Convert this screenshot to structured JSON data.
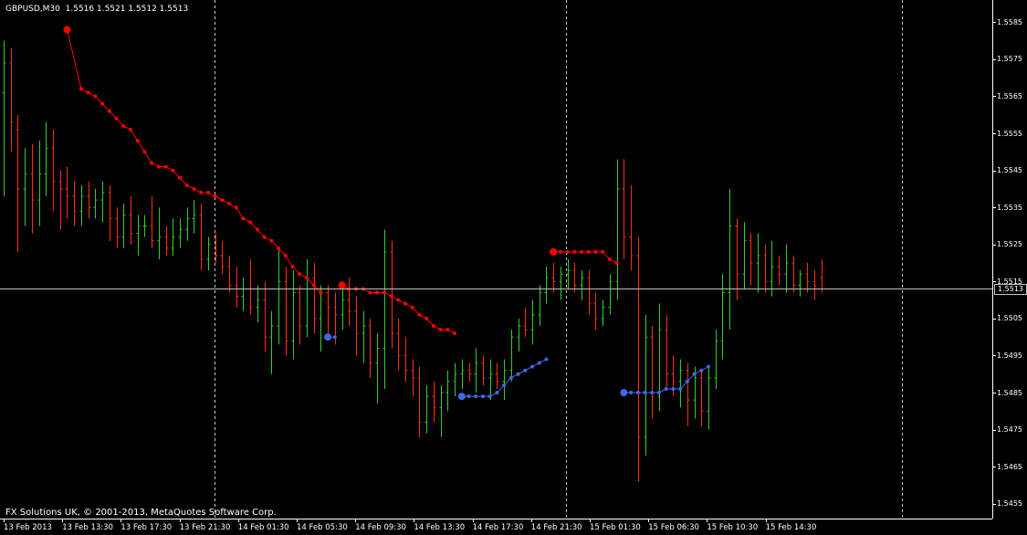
{
  "header": {
    "symbol_timeframe": "GBPUSD,M30",
    "ohlc": "1.5516 1.5521 1.5512 1.5513"
  },
  "footer": {
    "copyright": "FX Solutions UK, © 2001-2013, MetaQuotes Software Corp."
  },
  "colors": {
    "background": "#000000",
    "bull_bar": "#32cd32",
    "bear_bar": "#ff2b1a",
    "upper_indicator": "#ff0000",
    "lower_indicator": "#4169e1",
    "grid": "#c8c8c8",
    "axis_text": "#ffffff"
  },
  "current_price": "1.5513",
  "price_axis": [
    "1.5585",
    "1.5575",
    "1.5565",
    "1.5555",
    "1.5545",
    "1.5535",
    "1.5525",
    "1.5515",
    "1.5505",
    "1.5495",
    "1.5485",
    "1.5475",
    "1.5465",
    "1.5455"
  ],
  "time_axis": [
    "13 Feb 2013",
    "13 Feb 13:30",
    "13 Feb 17:30",
    "13 Feb 21:30",
    "14 Feb 01:30",
    "14 Feb 05:30",
    "14 Feb 09:30",
    "14 Feb 13:30",
    "14 Feb 17:30",
    "14 Feb 21:30",
    "15 Feb 01:30",
    "15 Feb 06:30",
    "15 Feb 10:30",
    "15 Feb 14:30"
  ],
  "chart_data": {
    "type": "bar",
    "symbol": "GBPUSD",
    "timeframe": "M30",
    "y_range": [
      1.5451,
      1.5591
    ],
    "day_separators": [
      "14 Feb 00:00",
      "15 Feb 00:00",
      "16 Feb 00:00"
    ],
    "last_ohlc": {
      "open": 1.5516,
      "high": 1.5521,
      "low": 1.5512,
      "close": 1.5513
    },
    "bars": [
      {
        "o": 1.5566,
        "h": 1.558,
        "l": 1.5538,
        "c": 1.5574
      },
      {
        "o": 1.5574,
        "h": 1.5578,
        "l": 1.555,
        "c": 1.5558
      },
      {
        "o": 1.5556,
        "h": 1.556,
        "l": 1.5523,
        "c": 1.554
      },
      {
        "o": 1.554,
        "h": 1.5551,
        "l": 1.553,
        "c": 1.5544
      },
      {
        "o": 1.5544,
        "h": 1.5552,
        "l": 1.5528,
        "c": 1.5537
      },
      {
        "o": 1.5537,
        "h": 1.5553,
        "l": 1.553,
        "c": 1.5544
      },
      {
        "o": 1.5544,
        "h": 1.5558,
        "l": 1.5538,
        "c": 1.5551
      },
      {
        "o": 1.5551,
        "h": 1.5556,
        "l": 1.5534,
        "c": 1.5542
      },
      {
        "o": 1.5542,
        "h": 1.5545,
        "l": 1.5529,
        "c": 1.554
      },
      {
        "o": 1.554,
        "h": 1.5546,
        "l": 1.5532,
        "c": 1.5538
      },
      {
        "o": 1.5538,
        "h": 1.5542,
        "l": 1.553,
        "c": 1.5534
      },
      {
        "o": 1.5534,
        "h": 1.5541,
        "l": 1.553,
        "c": 1.5538
      },
      {
        "o": 1.5538,
        "h": 1.5542,
        "l": 1.5532,
        "c": 1.5535
      },
      {
        "o": 1.5535,
        "h": 1.554,
        "l": 1.5532,
        "c": 1.5537
      },
      {
        "o": 1.5537,
        "h": 1.5542,
        "l": 1.5531,
        "c": 1.5539
      },
      {
        "o": 1.5539,
        "h": 1.5541,
        "l": 1.5526,
        "c": 1.5532
      },
      {
        "o": 1.5532,
        "h": 1.5535,
        "l": 1.5524,
        "c": 1.5527
      },
      {
        "o": 1.5527,
        "h": 1.5536,
        "l": 1.5524,
        "c": 1.5533
      },
      {
        "o": 1.5533,
        "h": 1.5538,
        "l": 1.5525,
        "c": 1.5528
      },
      {
        "o": 1.5528,
        "h": 1.5533,
        "l": 1.5522,
        "c": 1.553
      },
      {
        "o": 1.553,
        "h": 1.5533,
        "l": 1.5527,
        "c": 1.553
      },
      {
        "o": 1.553,
        "h": 1.5538,
        "l": 1.5524,
        "c": 1.5526
      },
      {
        "o": 1.5526,
        "h": 1.5535,
        "l": 1.5521,
        "c": 1.5527
      },
      {
        "o": 1.5527,
        "h": 1.553,
        "l": 1.5522,
        "c": 1.5524
      },
      {
        "o": 1.5524,
        "h": 1.5532,
        "l": 1.5522,
        "c": 1.5527
      },
      {
        "o": 1.5527,
        "h": 1.5532,
        "l": 1.5524,
        "c": 1.5529
      },
      {
        "o": 1.5529,
        "h": 1.5535,
        "l": 1.5526,
        "c": 1.5532
      },
      {
        "o": 1.5532,
        "h": 1.5537,
        "l": 1.5528,
        "c": 1.5533
      },
      {
        "o": 1.5533,
        "h": 1.5536,
        "l": 1.5518,
        "c": 1.5521
      },
      {
        "o": 1.5521,
        "h": 1.5527,
        "l": 1.5518,
        "c": 1.5525
      },
      {
        "o": 1.5525,
        "h": 1.5528,
        "l": 1.552,
        "c": 1.5522
      },
      {
        "o": 1.5522,
        "h": 1.5526,
        "l": 1.5517,
        "c": 1.5519
      },
      {
        "o": 1.5519,
        "h": 1.5522,
        "l": 1.5512,
        "c": 1.5514
      },
      {
        "o": 1.5514,
        "h": 1.5519,
        "l": 1.5508,
        "c": 1.5511
      },
      {
        "o": 1.5511,
        "h": 1.5516,
        "l": 1.5507,
        "c": 1.5513
      },
      {
        "o": 1.5513,
        "h": 1.5521,
        "l": 1.5506,
        "c": 1.5508
      },
      {
        "o": 1.5508,
        "h": 1.5514,
        "l": 1.5504,
        "c": 1.551
      },
      {
        "o": 1.551,
        "h": 1.5515,
        "l": 1.5496,
        "c": 1.55
      },
      {
        "o": 1.55,
        "h": 1.5507,
        "l": 1.549,
        "c": 1.5503
      },
      {
        "o": 1.5503,
        "h": 1.5524,
        "l": 1.5498,
        "c": 1.5515
      },
      {
        "o": 1.5515,
        "h": 1.5519,
        "l": 1.5495,
        "c": 1.5499
      },
      {
        "o": 1.5499,
        "h": 1.5518,
        "l": 1.5494,
        "c": 1.5512
      },
      {
        "o": 1.5512,
        "h": 1.5514,
        "l": 1.5498,
        "c": 1.5503
      },
      {
        "o": 1.5503,
        "h": 1.5521,
        "l": 1.55,
        "c": 1.5516
      },
      {
        "o": 1.5516,
        "h": 1.552,
        "l": 1.5501,
        "c": 1.5505
      },
      {
        "o": 1.5505,
        "h": 1.5514,
        "l": 1.5496,
        "c": 1.5512
      },
      {
        "o": 1.5512,
        "h": 1.5514,
        "l": 1.5501,
        "c": 1.5508
      },
      {
        "o": 1.5508,
        "h": 1.5512,
        "l": 1.5498,
        "c": 1.5506
      },
      {
        "o": 1.5506,
        "h": 1.5515,
        "l": 1.5502,
        "c": 1.551
      },
      {
        "o": 1.551,
        "h": 1.5516,
        "l": 1.5503,
        "c": 1.5507
      },
      {
        "o": 1.5507,
        "h": 1.5511,
        "l": 1.5495,
        "c": 1.5501
      },
      {
        "o": 1.5501,
        "h": 1.5507,
        "l": 1.5493,
        "c": 1.5503
      },
      {
        "o": 1.5503,
        "h": 1.5505,
        "l": 1.5489,
        "c": 1.5493
      },
      {
        "o": 1.5493,
        "h": 1.5501,
        "l": 1.5482,
        "c": 1.5497
      },
      {
        "o": 1.5497,
        "h": 1.5529,
        "l": 1.5486,
        "c": 1.5523
      },
      {
        "o": 1.5523,
        "h": 1.5526,
        "l": 1.5497,
        "c": 1.5501
      },
      {
        "o": 1.5501,
        "h": 1.5505,
        "l": 1.5491,
        "c": 1.5495
      },
      {
        "o": 1.5495,
        "h": 1.55,
        "l": 1.5488,
        "c": 1.5491
      },
      {
        "o": 1.5491,
        "h": 1.5494,
        "l": 1.5484,
        "c": 1.5489
      },
      {
        "o": 1.5489,
        "h": 1.5492,
        "l": 1.5473,
        "c": 1.5477
      },
      {
        "o": 1.5477,
        "h": 1.5487,
        "l": 1.5474,
        "c": 1.5484
      },
      {
        "o": 1.5484,
        "h": 1.5488,
        "l": 1.5477,
        "c": 1.5481
      },
      {
        "o": 1.5481,
        "h": 1.5487,
        "l": 1.5473,
        "c": 1.5485
      },
      {
        "o": 1.5485,
        "h": 1.5491,
        "l": 1.548,
        "c": 1.5488
      },
      {
        "o": 1.5488,
        "h": 1.5493,
        "l": 1.5484,
        "c": 1.549
      },
      {
        "o": 1.549,
        "h": 1.5494,
        "l": 1.5486,
        "c": 1.5491
      },
      {
        "o": 1.5491,
        "h": 1.5493,
        "l": 1.5488,
        "c": 1.549
      },
      {
        "o": 1.549,
        "h": 1.5497,
        "l": 1.5485,
        "c": 1.5493
      },
      {
        "o": 1.5493,
        "h": 1.5495,
        "l": 1.5487,
        "c": 1.5489
      },
      {
        "o": 1.5489,
        "h": 1.5494,
        "l": 1.5483,
        "c": 1.549
      },
      {
        "o": 1.549,
        "h": 1.5493,
        "l": 1.5486,
        "c": 1.5488
      },
      {
        "o": 1.5488,
        "h": 1.5494,
        "l": 1.5483,
        "c": 1.5491
      },
      {
        "o": 1.5491,
        "h": 1.5502,
        "l": 1.5488,
        "c": 1.55
      },
      {
        "o": 1.55,
        "h": 1.5505,
        "l": 1.5496,
        "c": 1.5503
      },
      {
        "o": 1.5503,
        "h": 1.5508,
        "l": 1.55,
        "c": 1.5502
      },
      {
        "o": 1.5502,
        "h": 1.551,
        "l": 1.5498,
        "c": 1.5506
      },
      {
        "o": 1.5506,
        "h": 1.5514,
        "l": 1.5503,
        "c": 1.5512
      },
      {
        "o": 1.5512,
        "h": 1.5519,
        "l": 1.5509,
        "c": 1.5516
      },
      {
        "o": 1.5516,
        "h": 1.552,
        "l": 1.5512,
        "c": 1.5515
      },
      {
        "o": 1.5515,
        "h": 1.5519,
        "l": 1.551,
        "c": 1.5517
      },
      {
        "o": 1.5517,
        "h": 1.5521,
        "l": 1.5513,
        "c": 1.5518
      },
      {
        "o": 1.5518,
        "h": 1.552,
        "l": 1.5512,
        "c": 1.5514
      },
      {
        "o": 1.5514,
        "h": 1.5518,
        "l": 1.551,
        "c": 1.5516
      },
      {
        "o": 1.5516,
        "h": 1.5518,
        "l": 1.5506,
        "c": 1.5509
      },
      {
        "o": 1.5509,
        "h": 1.5512,
        "l": 1.5502,
        "c": 1.5505
      },
      {
        "o": 1.5505,
        "h": 1.551,
        "l": 1.5503,
        "c": 1.5508
      },
      {
        "o": 1.5508,
        "h": 1.5517,
        "l": 1.5506,
        "c": 1.5515
      },
      {
        "o": 1.5515,
        "h": 1.5548,
        "l": 1.551,
        "c": 1.554
      },
      {
        "o": 1.554,
        "h": 1.5548,
        "l": 1.5521,
        "c": 1.5527
      },
      {
        "o": 1.5527,
        "h": 1.5541,
        "l": 1.5518,
        "c": 1.5522
      },
      {
        "o": 1.5522,
        "h": 1.5527,
        "l": 1.5461,
        "c": 1.5473
      },
      {
        "o": 1.5473,
        "h": 1.5506,
        "l": 1.5468,
        "c": 1.55
      },
      {
        "o": 1.55,
        "h": 1.5503,
        "l": 1.5478,
        "c": 1.5484
      },
      {
        "o": 1.5484,
        "h": 1.5509,
        "l": 1.548,
        "c": 1.5502
      },
      {
        "o": 1.5502,
        "h": 1.5506,
        "l": 1.5486,
        "c": 1.549
      },
      {
        "o": 1.549,
        "h": 1.5495,
        "l": 1.5484,
        "c": 1.5488
      },
      {
        "o": 1.5488,
        "h": 1.5494,
        "l": 1.5481,
        "c": 1.5491
      },
      {
        "o": 1.5491,
        "h": 1.5493,
        "l": 1.5476,
        "c": 1.5483
      },
      {
        "o": 1.5483,
        "h": 1.5492,
        "l": 1.5478,
        "c": 1.5489
      },
      {
        "o": 1.5489,
        "h": 1.5491,
        "l": 1.5476,
        "c": 1.548
      },
      {
        "o": 1.548,
        "h": 1.5492,
        "l": 1.5475,
        "c": 1.5489
      },
      {
        "o": 1.5489,
        "h": 1.5502,
        "l": 1.5486,
        "c": 1.5499
      },
      {
        "o": 1.5499,
        "h": 1.5517,
        "l": 1.5494,
        "c": 1.5512
      },
      {
        "o": 1.5512,
        "h": 1.554,
        "l": 1.5502,
        "c": 1.553
      },
      {
        "o": 1.553,
        "h": 1.5532,
        "l": 1.551,
        "c": 1.5517
      },
      {
        "o": 1.5517,
        "h": 1.5531,
        "l": 1.5513,
        "c": 1.5526
      },
      {
        "o": 1.5526,
        "h": 1.5528,
        "l": 1.5514,
        "c": 1.552
      },
      {
        "o": 1.552,
        "h": 1.5528,
        "l": 1.5512,
        "c": 1.5522
      },
      {
        "o": 1.5522,
        "h": 1.5525,
        "l": 1.5512,
        "c": 1.5515
      },
      {
        "o": 1.5515,
        "h": 1.5526,
        "l": 1.5511,
        "c": 1.5519
      },
      {
        "o": 1.5519,
        "h": 1.5522,
        "l": 1.5514,
        "c": 1.5517
      },
      {
        "o": 1.5517,
        "h": 1.5525,
        "l": 1.5512,
        "c": 1.552
      },
      {
        "o": 1.552,
        "h": 1.5522,
        "l": 1.5512,
        "c": 1.5514
      },
      {
        "o": 1.5514,
        "h": 1.5518,
        "l": 1.5511,
        "c": 1.5517
      },
      {
        "o": 1.5517,
        "h": 1.552,
        "l": 1.5512,
        "c": 1.5515
      },
      {
        "o": 1.5515,
        "h": 1.5518,
        "l": 1.551,
        "c": 1.5514
      },
      {
        "o": 1.5516,
        "h": 1.5521,
        "l": 1.5512,
        "c": 1.5513
      }
    ],
    "upper_indicator": [
      {
        "i": 9,
        "v": 1.5583
      },
      {
        "i": 11,
        "v": 1.5567
      },
      {
        "i": 12,
        "v": 1.5566
      },
      {
        "i": 13,
        "v": 1.5565
      },
      {
        "i": 14,
        "v": 1.5563
      },
      {
        "i": 15,
        "v": 1.5561
      },
      {
        "i": 16,
        "v": 1.5559
      },
      {
        "i": 17,
        "v": 1.5557
      },
      {
        "i": 18,
        "v": 1.5556
      },
      {
        "i": 19,
        "v": 1.5553
      },
      {
        "i": 20,
        "v": 1.555
      },
      {
        "i": 21,
        "v": 1.5547
      },
      {
        "i": 22,
        "v": 1.5546
      },
      {
        "i": 23,
        "v": 1.5546
      },
      {
        "i": 24,
        "v": 1.5545
      },
      {
        "i": 25,
        "v": 1.5543
      },
      {
        "i": 26,
        "v": 1.5541
      },
      {
        "i": 27,
        "v": 1.554
      },
      {
        "i": 28,
        "v": 1.5539
      },
      {
        "i": 29,
        "v": 1.5539
      },
      {
        "i": 30,
        "v": 1.5538
      },
      {
        "i": 31,
        "v": 1.5537
      },
      {
        "i": 32,
        "v": 1.5536
      },
      {
        "i": 33,
        "v": 1.5535
      },
      {
        "i": 34,
        "v": 1.5532
      },
      {
        "i": 35,
        "v": 1.5531
      },
      {
        "i": 36,
        "v": 1.5529
      },
      {
        "i": 37,
        "v": 1.5527
      },
      {
        "i": 38,
        "v": 1.5526
      },
      {
        "i": 39,
        "v": 1.5524
      },
      {
        "i": 40,
        "v": 1.5522
      },
      {
        "i": 41,
        "v": 1.5519
      },
      {
        "i": 42,
        "v": 1.5517
      },
      {
        "i": 43,
        "v": 1.5516
      },
      {
        "i": 44,
        "v": 1.5514
      },
      {
        "i": 45,
        "v": 1.5512
      },
      {
        "i": 48,
        "v": 1.5514
      },
      {
        "i": 49,
        "v": 1.5513
      },
      {
        "i": 50,
        "v": 1.5513
      },
      {
        "i": 51,
        "v": 1.5513
      },
      {
        "i": 52,
        "v": 1.5512
      },
      {
        "i": 53,
        "v": 1.5512
      },
      {
        "i": 54,
        "v": 1.5512
      },
      {
        "i": 55,
        "v": 1.5511
      },
      {
        "i": 56,
        "v": 1.551
      },
      {
        "i": 57,
        "v": 1.5509
      },
      {
        "i": 58,
        "v": 1.5508
      },
      {
        "i": 59,
        "v": 1.5506
      },
      {
        "i": 60,
        "v": 1.5505
      },
      {
        "i": 61,
        "v": 1.5503
      },
      {
        "i": 62,
        "v": 1.5502
      },
      {
        "i": 63,
        "v": 1.5502
      },
      {
        "i": 64,
        "v": 1.5501
      },
      {
        "i": 78,
        "v": 1.5523
      },
      {
        "i": 79,
        "v": 1.5523
      },
      {
        "i": 80,
        "v": 1.5523
      },
      {
        "i": 81,
        "v": 1.5523
      },
      {
        "i": 82,
        "v": 1.5523
      },
      {
        "i": 83,
        "v": 1.5523
      },
      {
        "i": 84,
        "v": 1.5523
      },
      {
        "i": 85,
        "v": 1.5523
      },
      {
        "i": 86,
        "v": 1.5521
      },
      {
        "i": 87,
        "v": 1.552
      }
    ],
    "lower_indicator": [
      {
        "i": 46,
        "v": 1.55
      },
      {
        "i": 47,
        "v": 1.55
      },
      {
        "i": 65,
        "v": 1.5484
      },
      {
        "i": 66,
        "v": 1.5484
      },
      {
        "i": 67,
        "v": 1.5484
      },
      {
        "i": 68,
        "v": 1.5484
      },
      {
        "i": 69,
        "v": 1.5484
      },
      {
        "i": 70,
        "v": 1.5485
      },
      {
        "i": 71,
        "v": 1.5487
      },
      {
        "i": 72,
        "v": 1.5489
      },
      {
        "i": 73,
        "v": 1.549
      },
      {
        "i": 74,
        "v": 1.5491
      },
      {
        "i": 75,
        "v": 1.5492
      },
      {
        "i": 76,
        "v": 1.5493
      },
      {
        "i": 77,
        "v": 1.5494
      },
      {
        "i": 88,
        "v": 1.5485
      },
      {
        "i": 89,
        "v": 1.5485
      },
      {
        "i": 90,
        "v": 1.5485
      },
      {
        "i": 91,
        "v": 1.5485
      },
      {
        "i": 92,
        "v": 1.5485
      },
      {
        "i": 93,
        "v": 1.5485
      },
      {
        "i": 94,
        "v": 1.5486
      },
      {
        "i": 95,
        "v": 1.5486
      },
      {
        "i": 96,
        "v": 1.5486
      },
      {
        "i": 97,
        "v": 1.5488
      },
      {
        "i": 98,
        "v": 1.549
      },
      {
        "i": 99,
        "v": 1.5491
      },
      {
        "i": 100,
        "v": 1.5492
      }
    ],
    "grid": false
  }
}
